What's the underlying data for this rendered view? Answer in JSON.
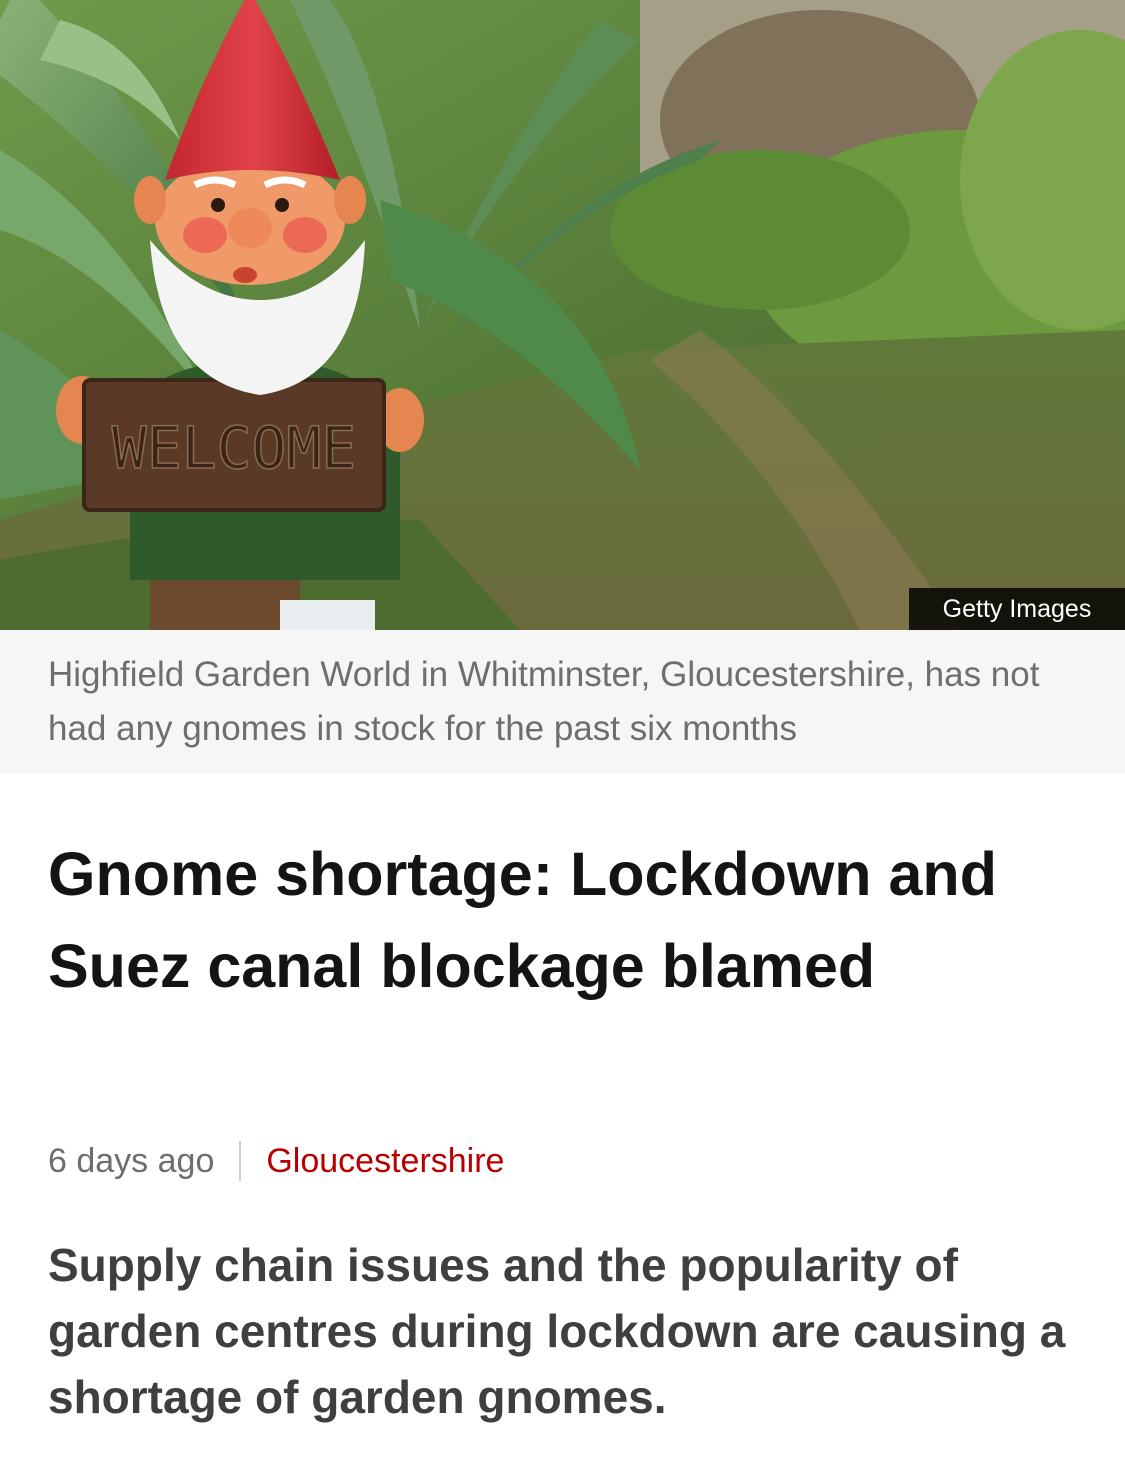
{
  "image": {
    "credit": "Getty Images",
    "sign_text": "WELCOME",
    "caption": "Highfield Garden World in Whitminster, Gloucestershire, has not had any gnomes in stock for the past six months"
  },
  "article": {
    "headline": "Gnome shortage: Lockdown and Suez canal blockage blamed",
    "time": "6 days ago",
    "topic": "Gloucestershire",
    "intro": "Supply chain issues and the popularity of garden centres during lockdown are causing a shortage of garden gnomes."
  },
  "colors": {
    "topic_link": "#b80000",
    "caption_bg": "#f6f6f6",
    "headline": "#141414"
  }
}
